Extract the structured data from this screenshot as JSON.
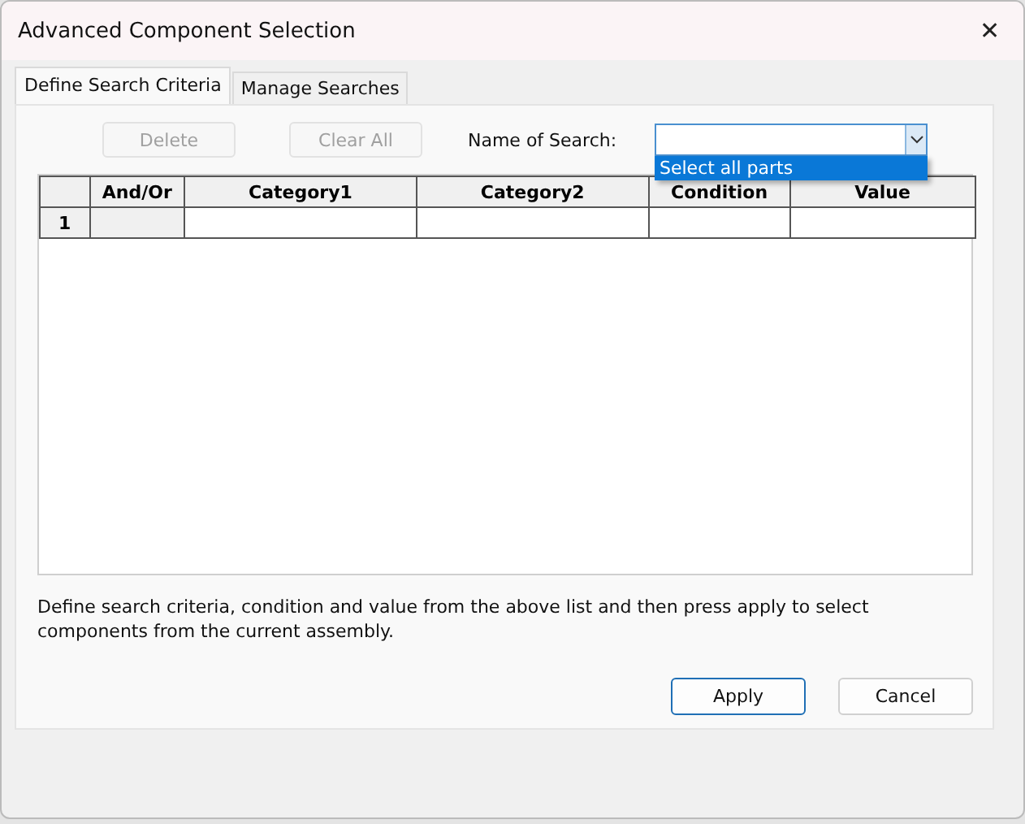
{
  "window": {
    "title": "Advanced Component Selection",
    "close": "✕"
  },
  "tabs": [
    {
      "label": "Define Search Criteria",
      "selected": true
    },
    {
      "label": "Manage Searches",
      "selected": false
    }
  ],
  "toolbar": {
    "buttons": [
      {
        "label": "Delete",
        "disabled": true
      },
      {
        "label": "Clear All",
        "disabled": true
      }
    ],
    "search_label": "Name of Search:",
    "dropdown_open": true,
    "dropdown_items": [
      {
        "label": "Select all parts",
        "selected": true
      }
    ]
  },
  "table": {
    "columns": [
      "And/Or",
      "Category1",
      "Category2",
      "Condition",
      "Value"
    ],
    "rows": [
      {
        "number": "1"
      }
    ]
  },
  "description": "Define search criteria, condition and value from the above list and then press apply to select components from the current assembly.",
  "buttons": [
    {
      "label": "Apply",
      "default": true
    },
    {
      "label": "Cancel",
      "default": false
    }
  ]
}
